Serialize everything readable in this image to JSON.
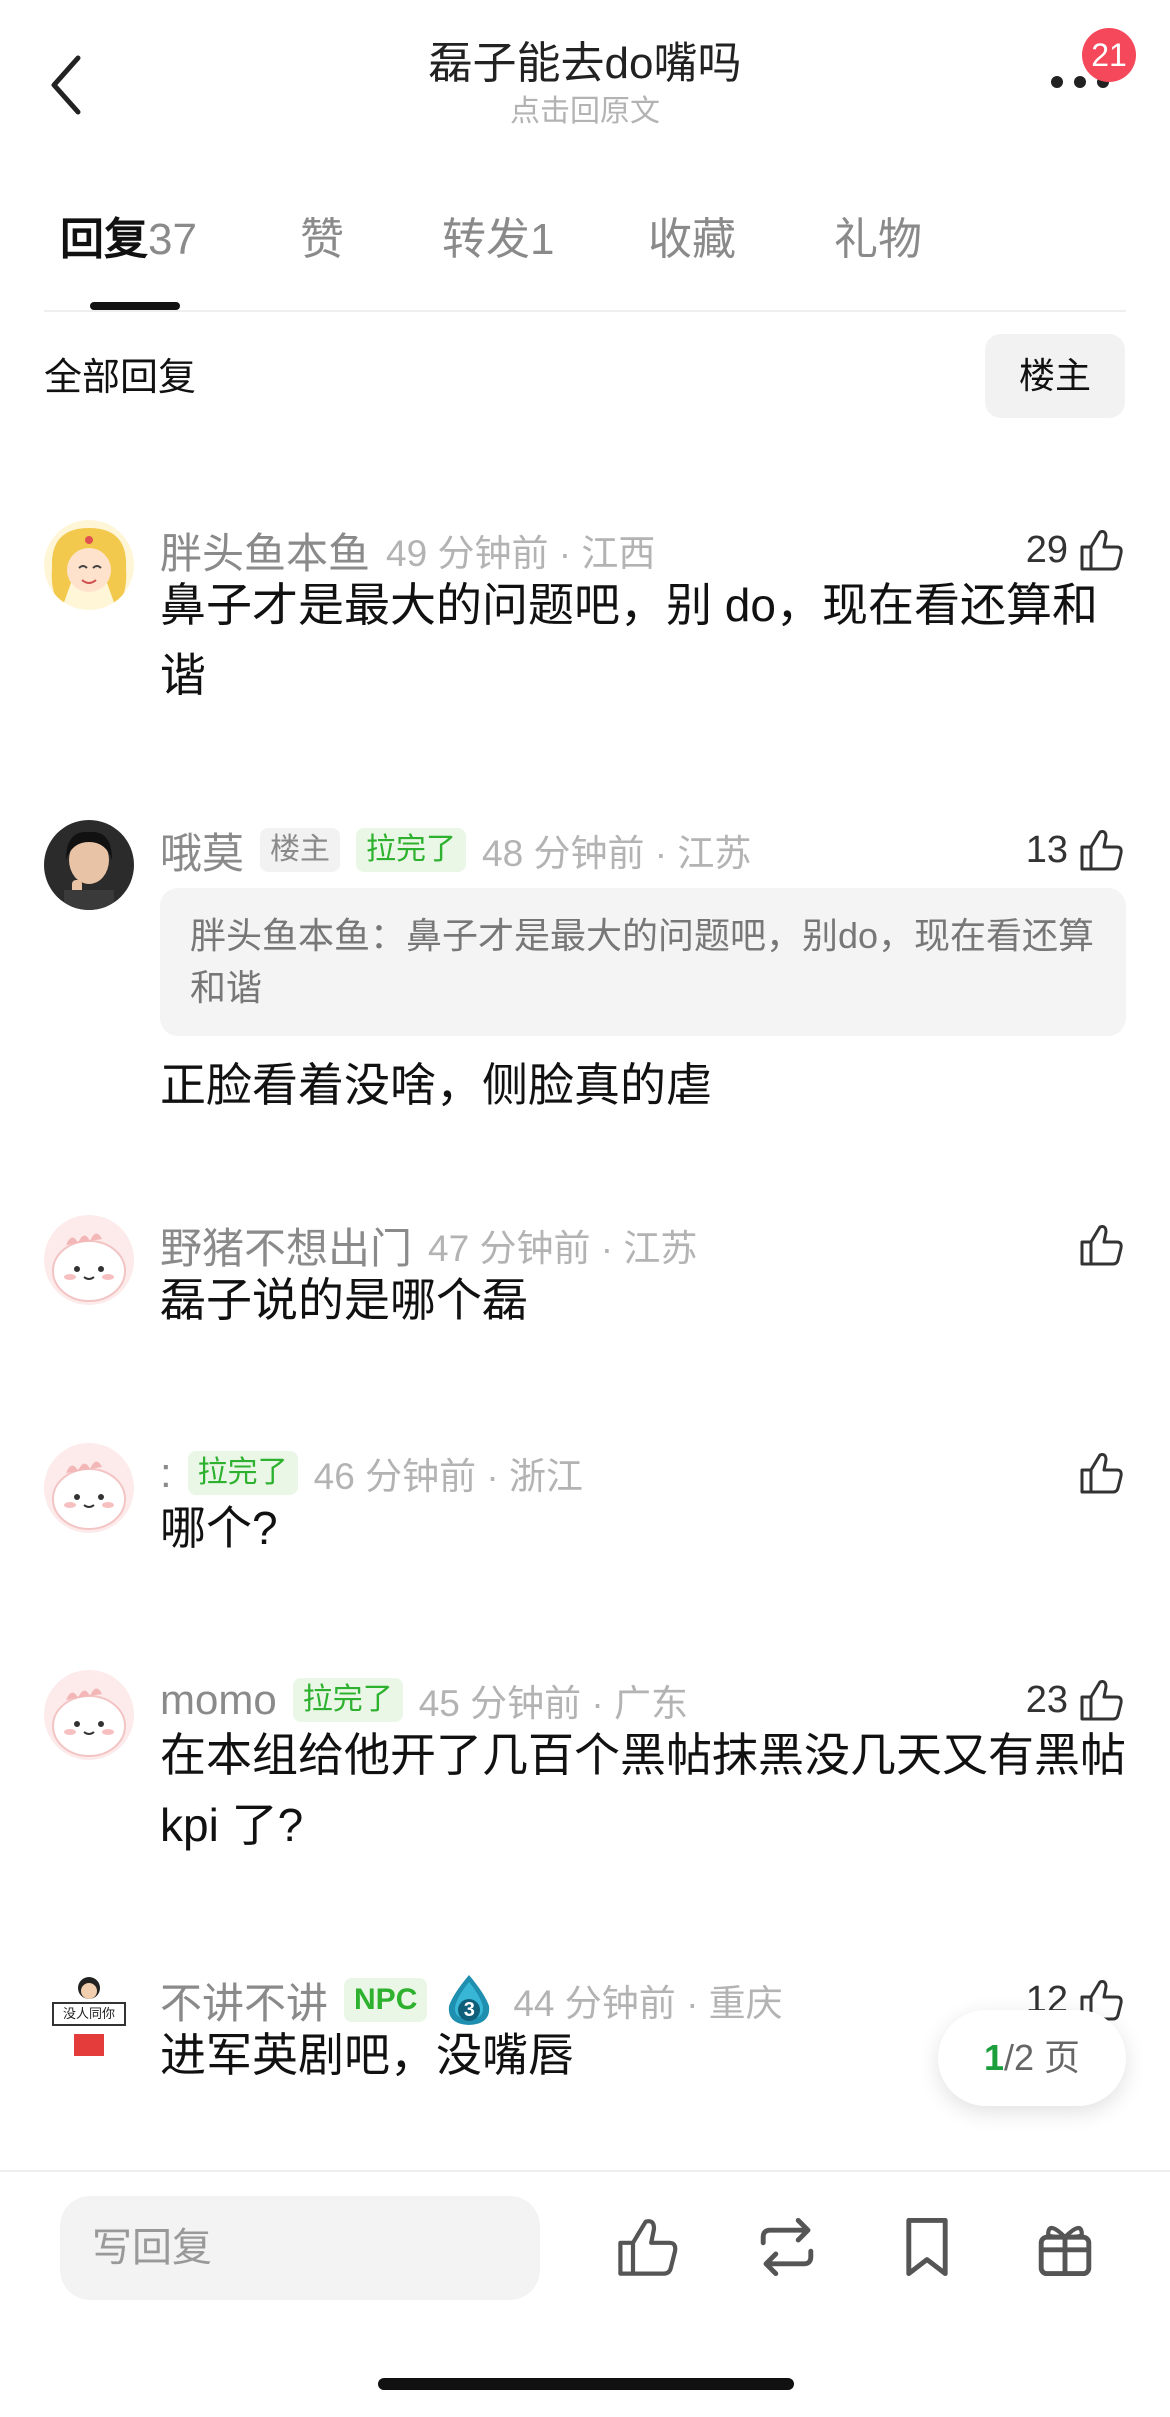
{
  "header": {
    "title": "磊子能去do嘴吗",
    "subtitle": "点击回原文",
    "notification_count": "21"
  },
  "tabs": [
    {
      "label": "回复",
      "count": "37",
      "active": true
    },
    {
      "label": "赞",
      "count": ""
    },
    {
      "label": "转发",
      "count": "1"
    },
    {
      "label": "收藏",
      "count": ""
    },
    {
      "label": "礼物",
      "count": ""
    }
  ],
  "filter": {
    "label": "全部回复",
    "button": "楼主"
  },
  "comments": [
    {
      "name": "胖头鱼本鱼",
      "time": "49 分钟前 · 江西",
      "likes": "29",
      "text": "鼻子才是最大的问题吧，别 do，现在看还算和谐"
    },
    {
      "name": "哦莫",
      "tag1": "楼主",
      "tag2": "拉完了",
      "time": "48 分钟前 · 江苏",
      "likes": "13",
      "quote": "胖头鱼本鱼：鼻子才是最大的问题吧，别do，现在看还算和谐",
      "text": "正脸看着没啥，侧脸真的虐"
    },
    {
      "name": "野猪不想出门",
      "time": "47 分钟前 · 江苏",
      "likes": "",
      "text": "磊子说的是哪个磊"
    },
    {
      "name": ":",
      "tag2": "拉完了",
      "time": "46 分钟前 · 浙江",
      "likes": "",
      "text": "哪个?"
    },
    {
      "name": "momo",
      "tag2": "拉完了",
      "time": "45 分钟前 · 广东",
      "likes": "23",
      "text": "在本组给他开了几百个黑帖抹黑没几天又有黑帖 kpi 了?"
    },
    {
      "name": "不讲不讲",
      "tag_npc": "NPC",
      "level": "3",
      "time": "44 分钟前 · 重庆",
      "likes": "12",
      "text": "进军英剧吧，没嘴唇",
      "avatar_sign": "没人同你"
    }
  ],
  "pager": {
    "current": "1",
    "total": "/2 页"
  },
  "bottom": {
    "reply_placeholder": "写回复"
  },
  "colors": {
    "accent_green": "#2db12f",
    "badge_red": "#f5495b"
  }
}
